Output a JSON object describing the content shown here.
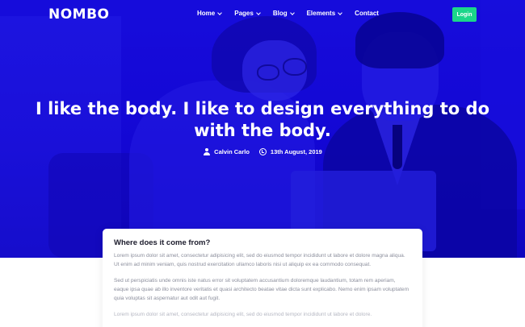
{
  "brand": {
    "logo": "NOMBO"
  },
  "nav": {
    "items": [
      {
        "label": "Home",
        "has_dropdown": true
      },
      {
        "label": "Pages",
        "has_dropdown": true
      },
      {
        "label": "Blog",
        "has_dropdown": true
      },
      {
        "label": "Elements",
        "has_dropdown": true
      },
      {
        "label": "Contact",
        "has_dropdown": false
      }
    ],
    "login_label": "Login"
  },
  "hero": {
    "title": "I like the body. I like to design everything to do with the body.",
    "author": "Calvin Carlo",
    "date": "13th August, 2019"
  },
  "article": {
    "heading": "Where does it come from?",
    "paragraphs": [
      "Lorem ipsum dolor sit amet, consectetur adipisicing elit, sed do eiusmod tempor incididunt ut labore et dolore magna aliqua. Ut enim ad minim veniam, quis nostrud exercitation ullamco laboris nisi ut aliquip ex ea commodo consequat.",
      "Sed ut perspiciatis unde omnis iste natus error sit voluptatem accusantium doloremque laudantium, totam rem aperiam, eaque ipsa quae ab illo inventore veritatis et quasi architecto beatae vitae dicta sunt explicabo. Nemo enim ipsam voluptatem quia voluptas sit aspernatur aut odit aut fugit.",
      "Lorem ipsum dolor sit amet, consectetur adipisicing elit, sed do eiusmod tempor incididunt ut labore et dolore."
    ]
  },
  "colors": {
    "hero_blue": "#1608d6",
    "login_green": "#1bd68a",
    "text_muted": "#8b8e9c"
  }
}
